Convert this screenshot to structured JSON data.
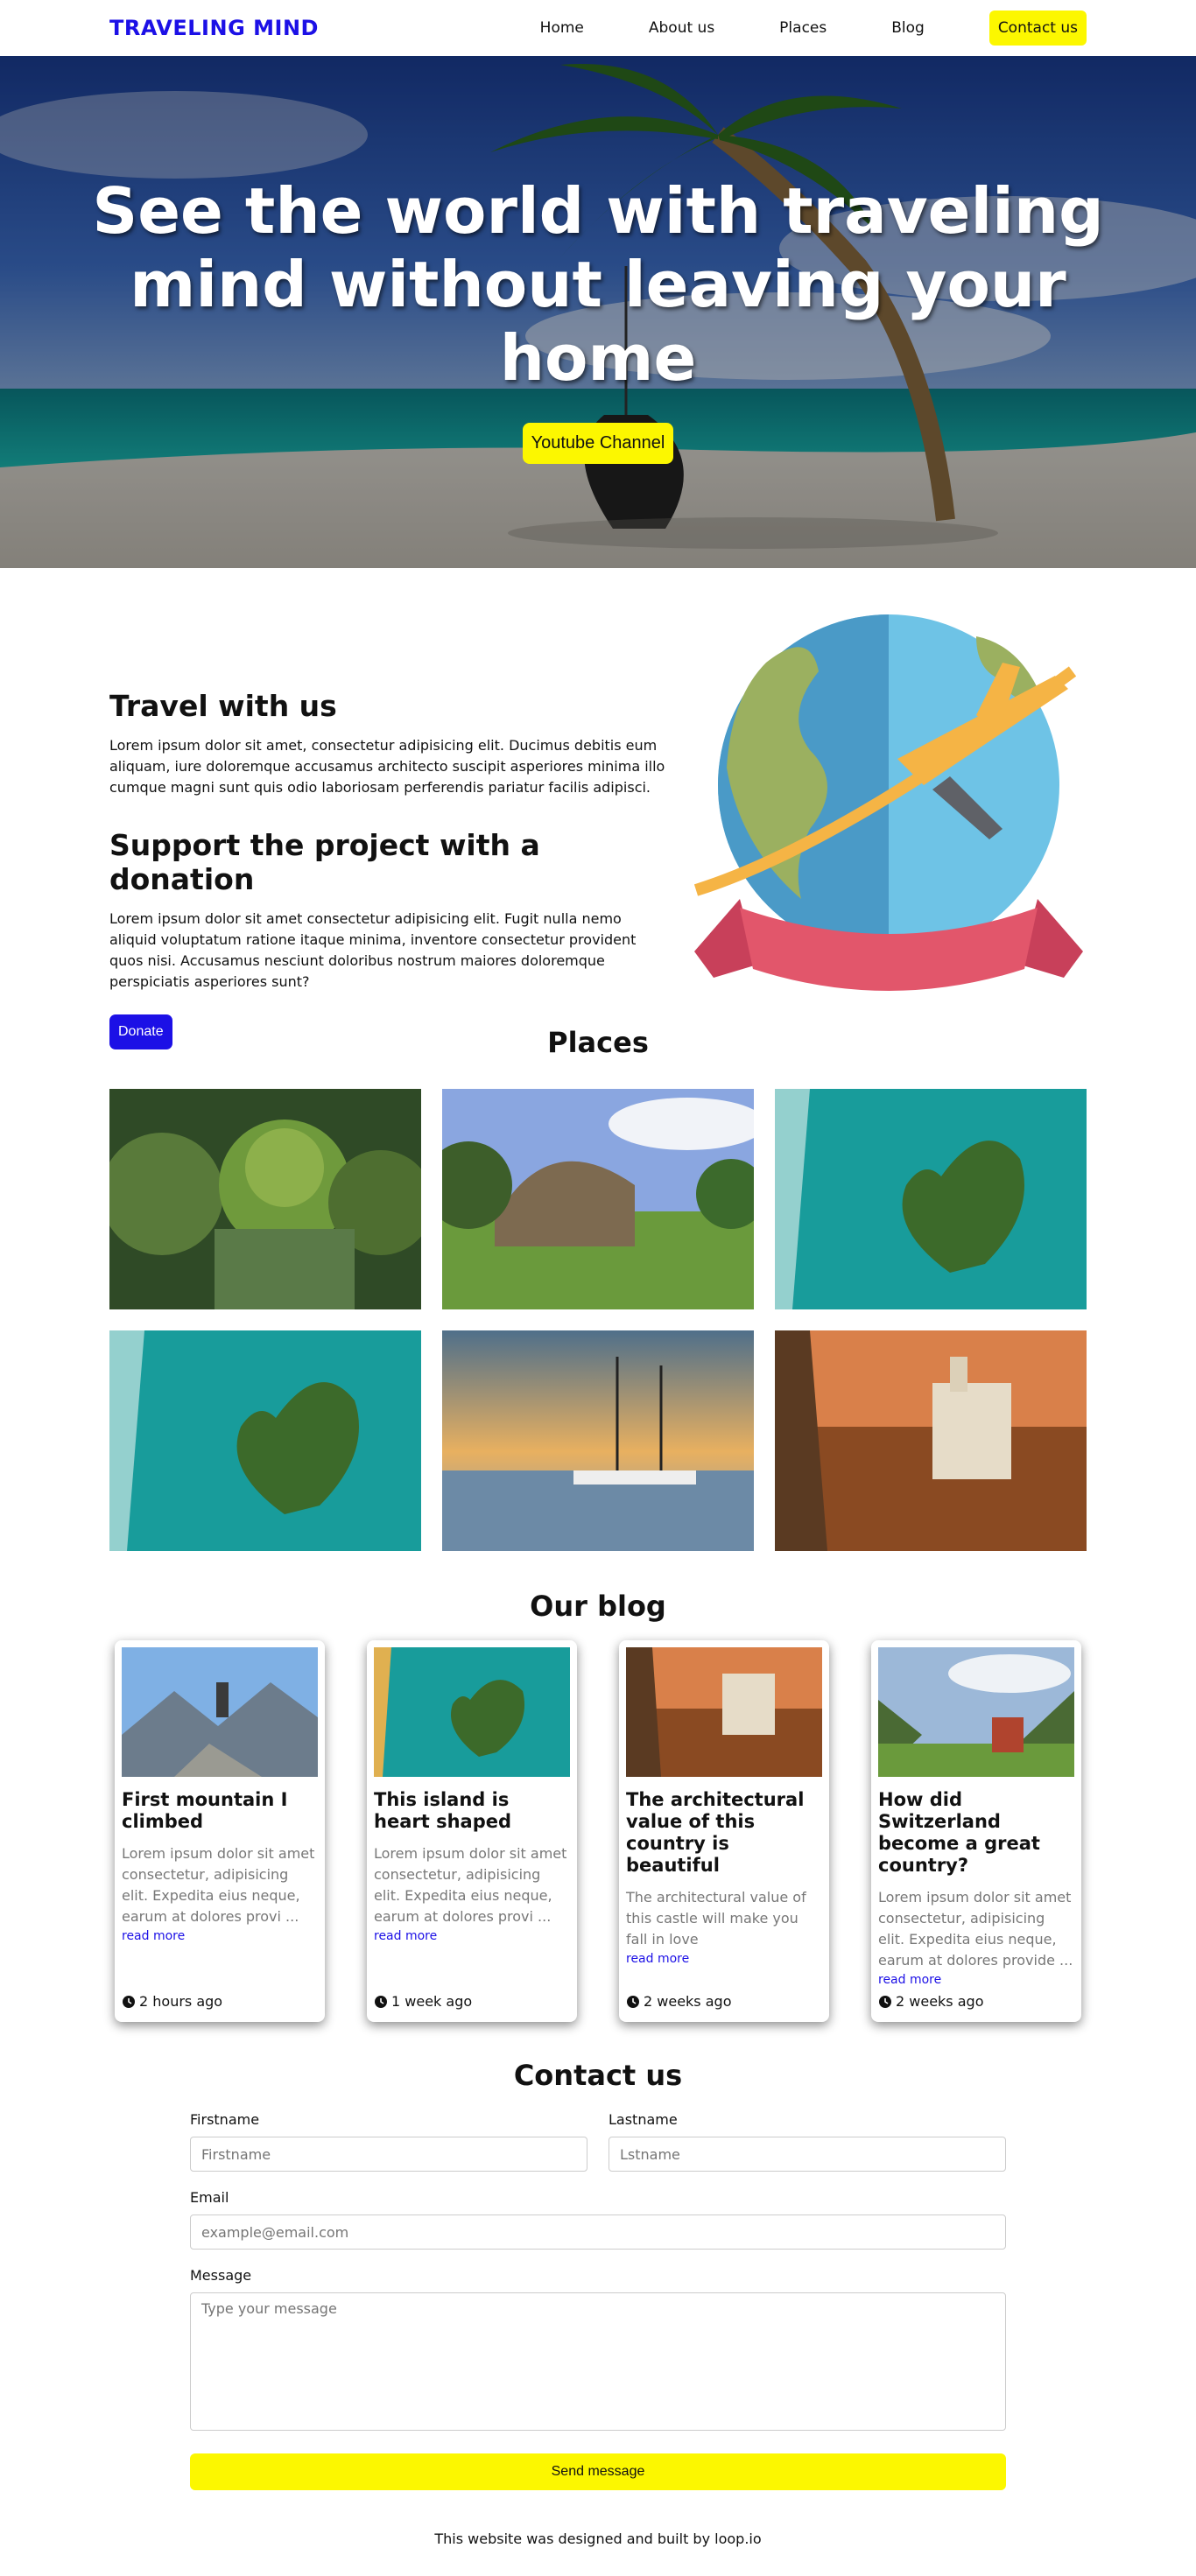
{
  "nav": {
    "logo": "TRAVELING MIND",
    "links": [
      "Home",
      "About us",
      "Places",
      "Blog"
    ],
    "contact": "Contact us"
  },
  "hero": {
    "title": "See the world with traveling mind without leaving your home",
    "button": "Youtube Channel"
  },
  "about": {
    "heading1": "Travel with us",
    "text1": "Lorem ipsum dolor sit amet, consectetur adipisicing elit. Ducimus debitis eum aliquam, iure doloremque accusamus architecto suscipit asperiores minima illo cumque magni sunt quis odio laboriosam perferendis pariatur facilis adipisci.",
    "heading2": "Support the project with a donation",
    "text2": "Lorem ipsum dolor sit amet consectetur adipisicing elit. Fugit nulla nemo aliquid voluptatum ratione itaque minima, inventore consectetur provident quos nisi. Accusamus nesciunt doloribus nostrum maiores doloremque perspiciatis asperiores sunt?",
    "donate": "Donate"
  },
  "places": {
    "title": "Places"
  },
  "blog": {
    "title": "Our blog",
    "read_more": "read more",
    "cards": [
      {
        "title": "First mountain I climbed",
        "excerpt": "Lorem ipsum dolor sit amet consectetur, adipisicing elit. Expedita eius neque, earum at dolores provi ...",
        "time": "2 hours ago"
      },
      {
        "title": "This island is heart shaped",
        "excerpt": "Lorem ipsum dolor sit amet consectetur, adipisicing elit. Expedita eius neque, earum at dolores provi ...",
        "time": "1 week ago"
      },
      {
        "title": "The architectural value of this country is beautiful",
        "excerpt": "The architectural value of this castle will make you fall in love",
        "time": "2 weeks ago"
      },
      {
        "title": "How did Switzerland become a great country?",
        "excerpt": "Lorem ipsum dolor sit amet consectetur, adipisicing elit. Expedita eius neque, earum at dolores provide ...",
        "time": "2 weeks ago"
      }
    ]
  },
  "contact": {
    "title": "Contact us",
    "firstname_label": "Firstname",
    "firstname_placeholder": "Firstname",
    "lastname_label": "Lastname",
    "lastname_placeholder": "Lstname",
    "email_label": "Email",
    "email_placeholder": "example@email.com",
    "message_label": "Message",
    "message_placeholder": "Type your message",
    "send": "Send message"
  },
  "footer": "This website was designed and built by loop.io",
  "colors": {
    "brand_blue": "#1c10e6",
    "accent_yellow": "#fcf700"
  }
}
